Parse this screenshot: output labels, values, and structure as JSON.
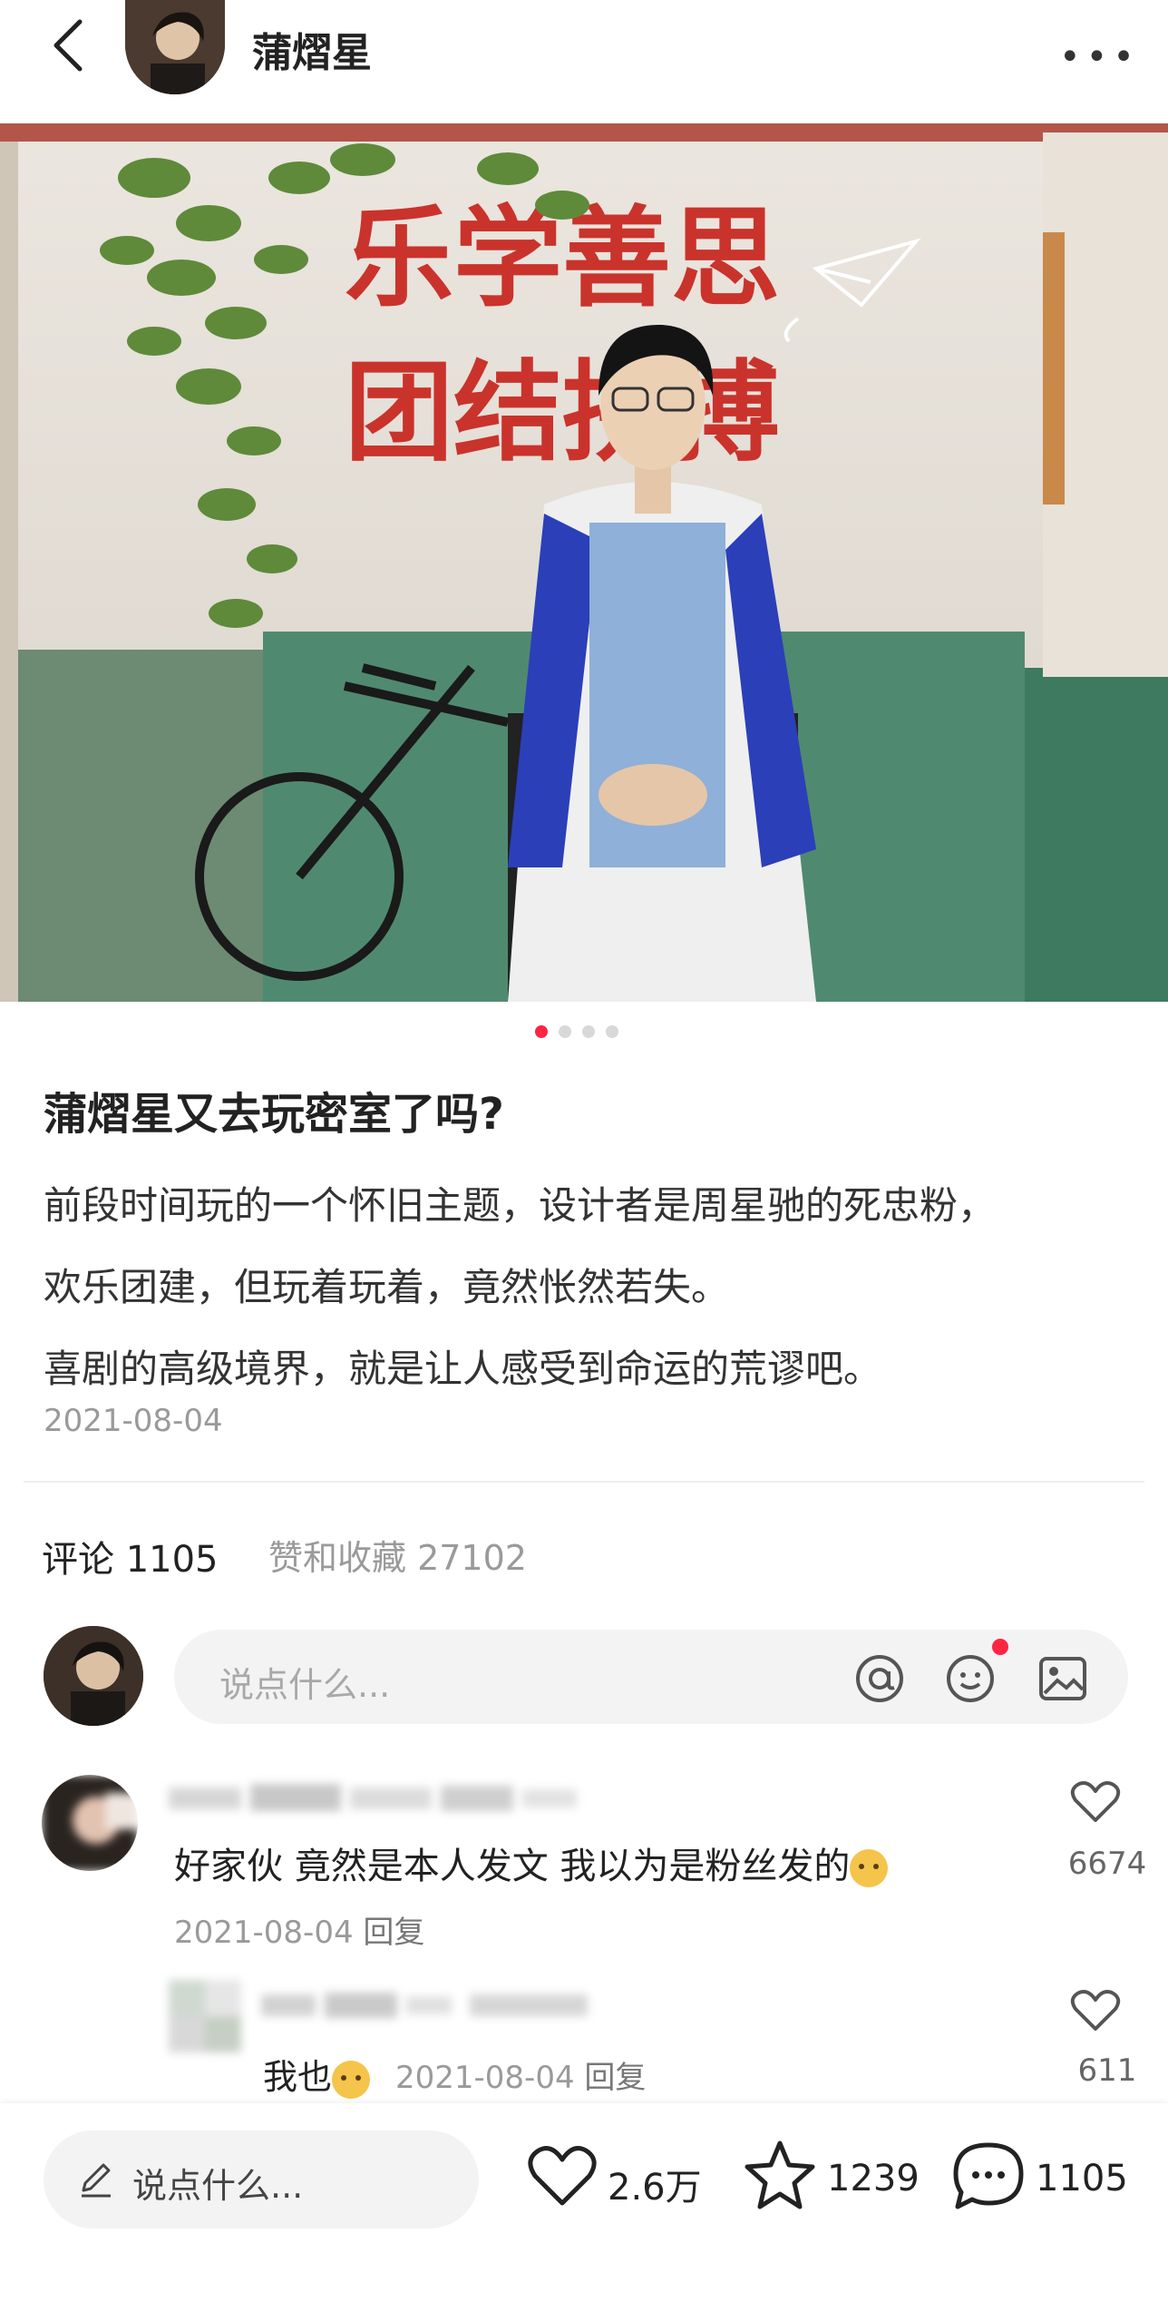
{
  "header": {
    "username": "蒲熠星",
    "more": "•••"
  },
  "photo": {
    "wall_text_line1": "乐学善思",
    "wall_text_line2": "团结拼搏",
    "carousel_count": 4,
    "carousel_active": 1
  },
  "post": {
    "title": "蒲熠星又去玩密室了吗?",
    "lines": [
      "前段时间玩的一个怀旧主题，设计者是周星驰的死忠粉，",
      "欢乐团建，但玩着玩着，竟然怅然若失。",
      "喜剧的高级境界，就是让人感受到命运的荒谬吧。"
    ],
    "date": "2021-08-04"
  },
  "stats": {
    "comments_label": "评论 1105",
    "likes_collect_label": "赞和收藏 27102"
  },
  "comment_input": {
    "placeholder": "说点什么..."
  },
  "comments": [
    {
      "text": "好家伙 竟然是本人发文 我以为是粉丝发的",
      "date": "2021-08-04",
      "reply_label": "回复",
      "likes": "6674"
    }
  ],
  "reply": {
    "text": "我也",
    "date": "2021-08-04",
    "reply_label": "回复",
    "likes": "611"
  },
  "bottom_bar": {
    "placeholder": "说点什么...",
    "likes": "2.6万",
    "stars": "1239",
    "comments": "1105"
  },
  "colors": {
    "accent": "#ff2442",
    "muted": "#9a9a9a"
  }
}
